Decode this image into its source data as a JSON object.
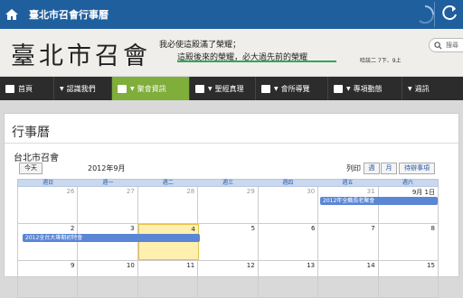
{
  "topbar": {
    "title": "臺北市召會行事曆"
  },
  "banner": {
    "logo": "臺北市召會",
    "verse_line1": "我必使這殿滿了榮耀；",
    "verse_line2": "這殿後來的榮耀，必大過先前的榮耀",
    "verse_ref": "哈該二 7下、9上",
    "search_label": "搜尋"
  },
  "nav": {
    "items": [
      {
        "label": "首頁"
      },
      {
        "label": "認識我們"
      },
      {
        "label": "聚會資訊"
      },
      {
        "label": "聖經真理"
      },
      {
        "label": "會所導覽"
      },
      {
        "label": "專項動態"
      },
      {
        "label": "週訊"
      }
    ]
  },
  "page": {
    "heading": "行事曆",
    "calendar_title": "台北市召會",
    "today_label": "今天",
    "month_label": "2012年9月",
    "print_label": "列印",
    "view_week": "週",
    "view_month": "月",
    "view_agenda": "待辦事項"
  },
  "calendar": {
    "weekdays": [
      "週日",
      "週一",
      "週二",
      "週三",
      "週四",
      "週五",
      "週六"
    ],
    "weeks": [
      [
        "26",
        "27",
        "28",
        "29",
        "30",
        "31",
        "9月 1日"
      ],
      [
        "2",
        "3",
        "4",
        "5",
        "6",
        "7",
        "8"
      ],
      [
        "9",
        "10",
        "11",
        "12",
        "13",
        "14",
        "15"
      ]
    ],
    "events": [
      {
        "title": "2012年全職長老聚會"
      },
      {
        "title": "2012全台大專期初特會"
      }
    ]
  },
  "colors": {
    "topbar": "#1f5f9e",
    "nav_active": "#7fae3b",
    "event": "#5b86d6",
    "today": "#fff0b0"
  }
}
